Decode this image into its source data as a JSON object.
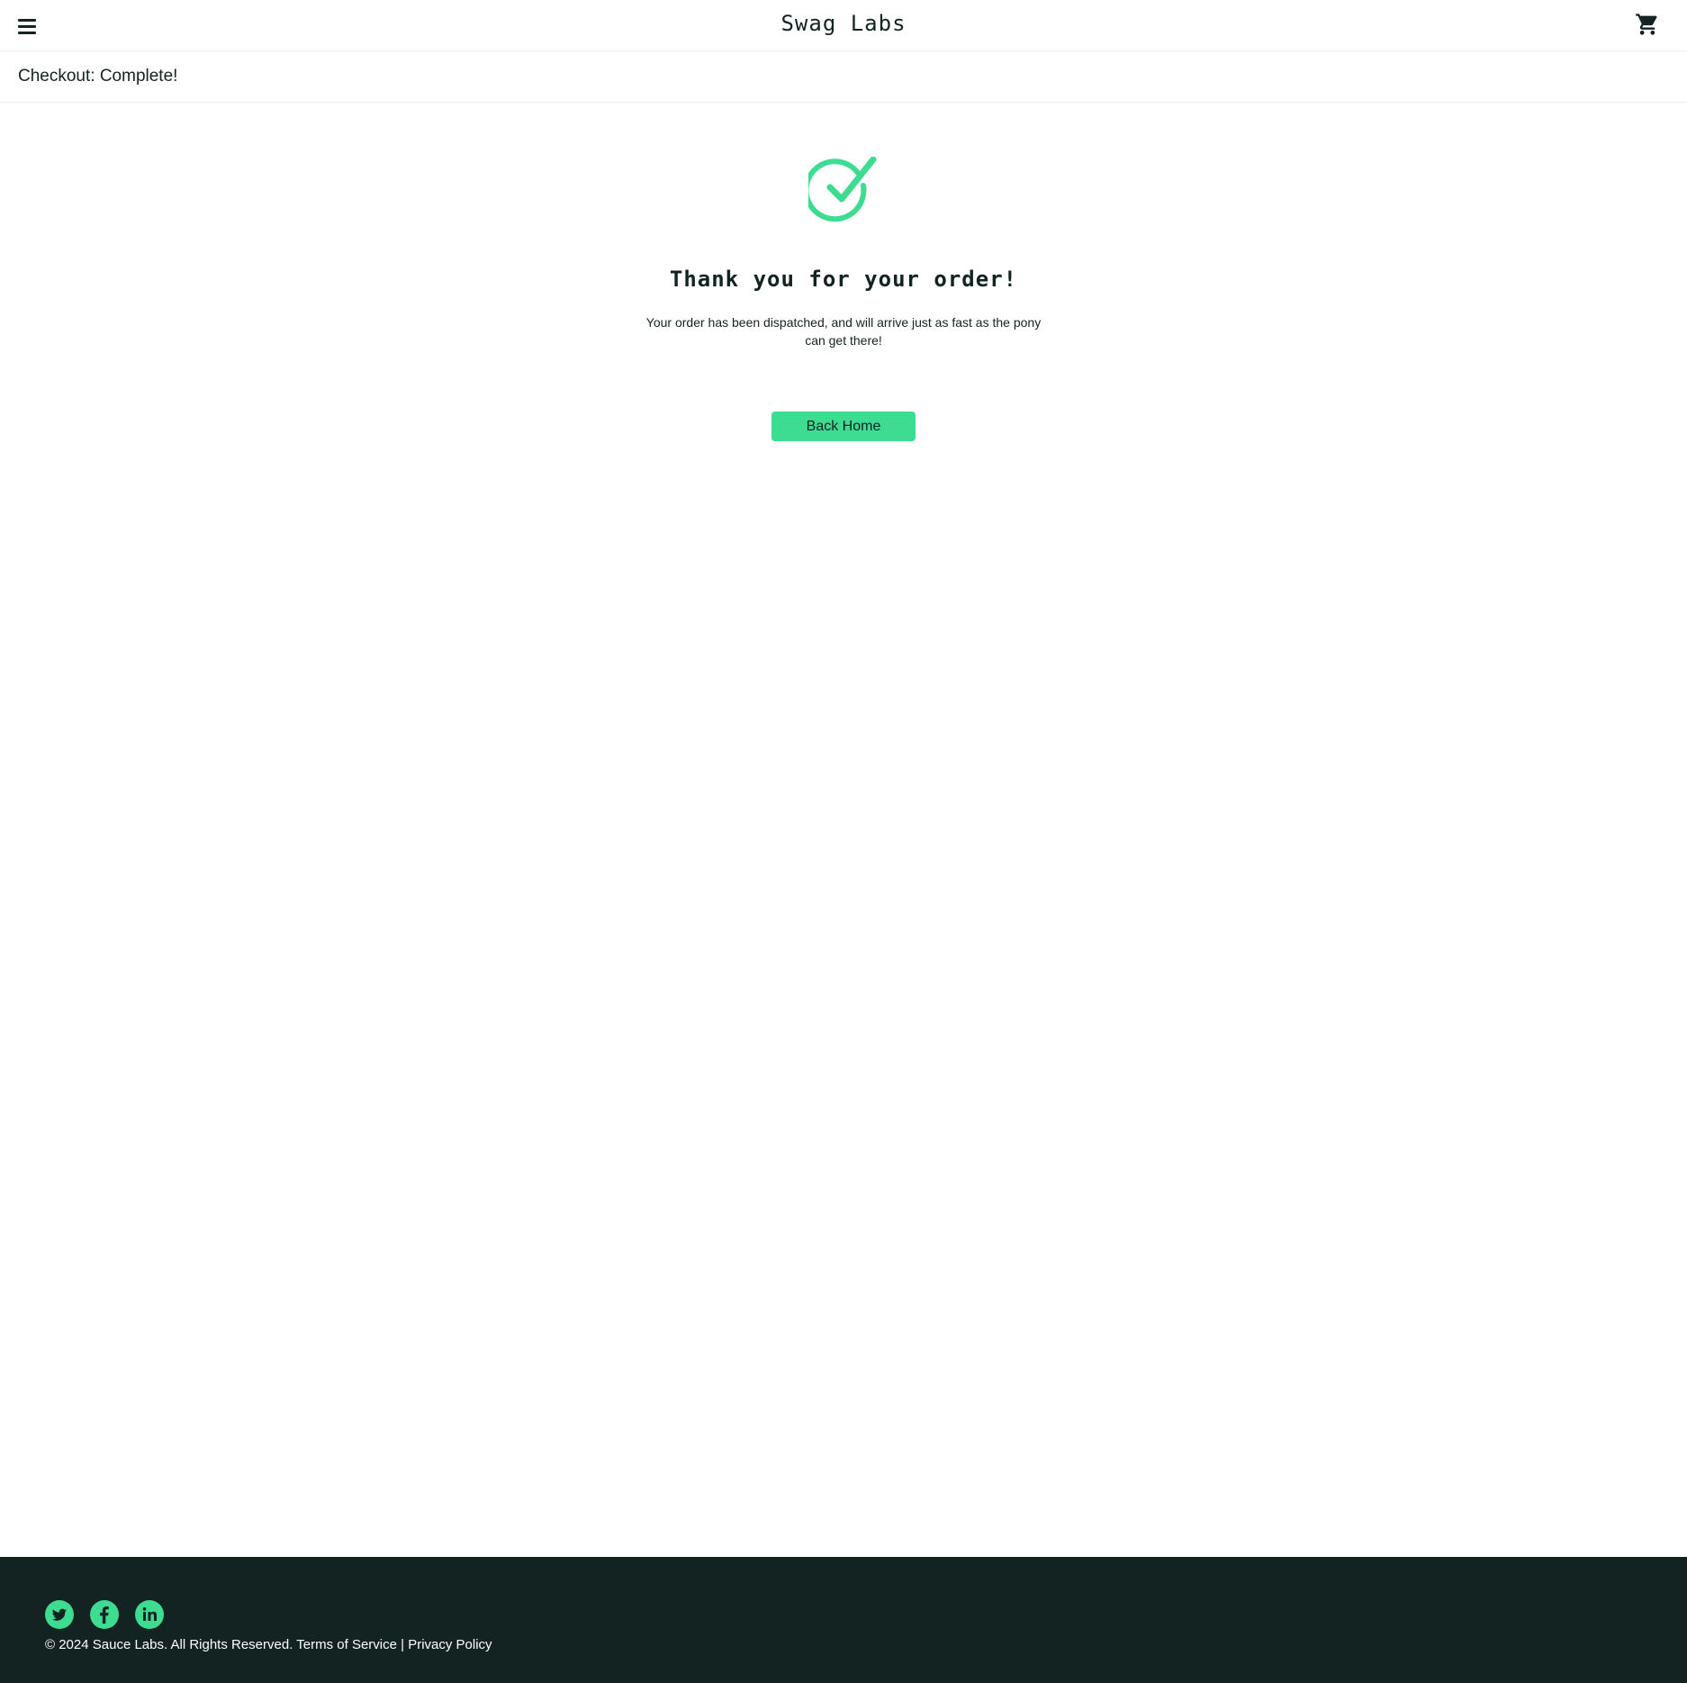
{
  "header": {
    "title": "Swag Labs",
    "menu_icon": "hamburger-menu-icon",
    "cart_icon": "shopping-cart-icon"
  },
  "subheader": {
    "title": "Checkout: Complete!"
  },
  "complete": {
    "icon": "checkmark-circle-icon",
    "header": "Thank you for your order!",
    "text": "Your order has been dispatched, and will arrive just as fast as the pony can get there!",
    "button_label": "Back Home"
  },
  "footer": {
    "social": [
      "twitter-icon",
      "facebook-icon",
      "linkedin-icon"
    ],
    "copyright": "© 2024 Sauce Labs. All Rights Reserved. Terms of Service | Privacy Policy"
  },
  "colors": {
    "accent": "#3ddc91",
    "footer_bg": "#132322",
    "text": "#132322"
  }
}
